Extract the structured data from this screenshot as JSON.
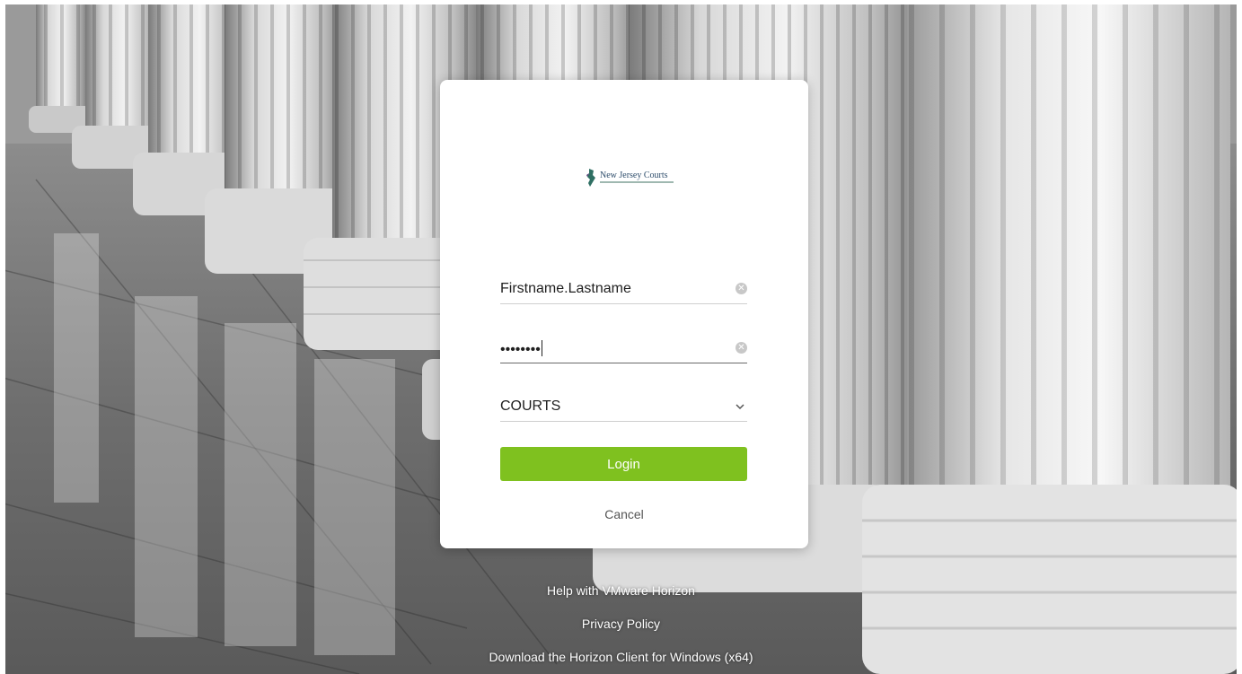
{
  "login": {
    "logo_text": "New Jersey Courts",
    "username_value": "Firstname.Lastname",
    "password_mask": "••••••••",
    "domain_value": "COURTS",
    "login_label": "Login",
    "cancel_label": "Cancel",
    "accent_color": "#7fc11f",
    "clear_icon": "clear-icon",
    "dropdown_icon": "chevron-down-icon"
  },
  "footer": {
    "help_link": "Help with VMware Horizon",
    "privacy_link": "Privacy Policy",
    "download_link": "Download the Horizon Client for Windows (x64)"
  }
}
